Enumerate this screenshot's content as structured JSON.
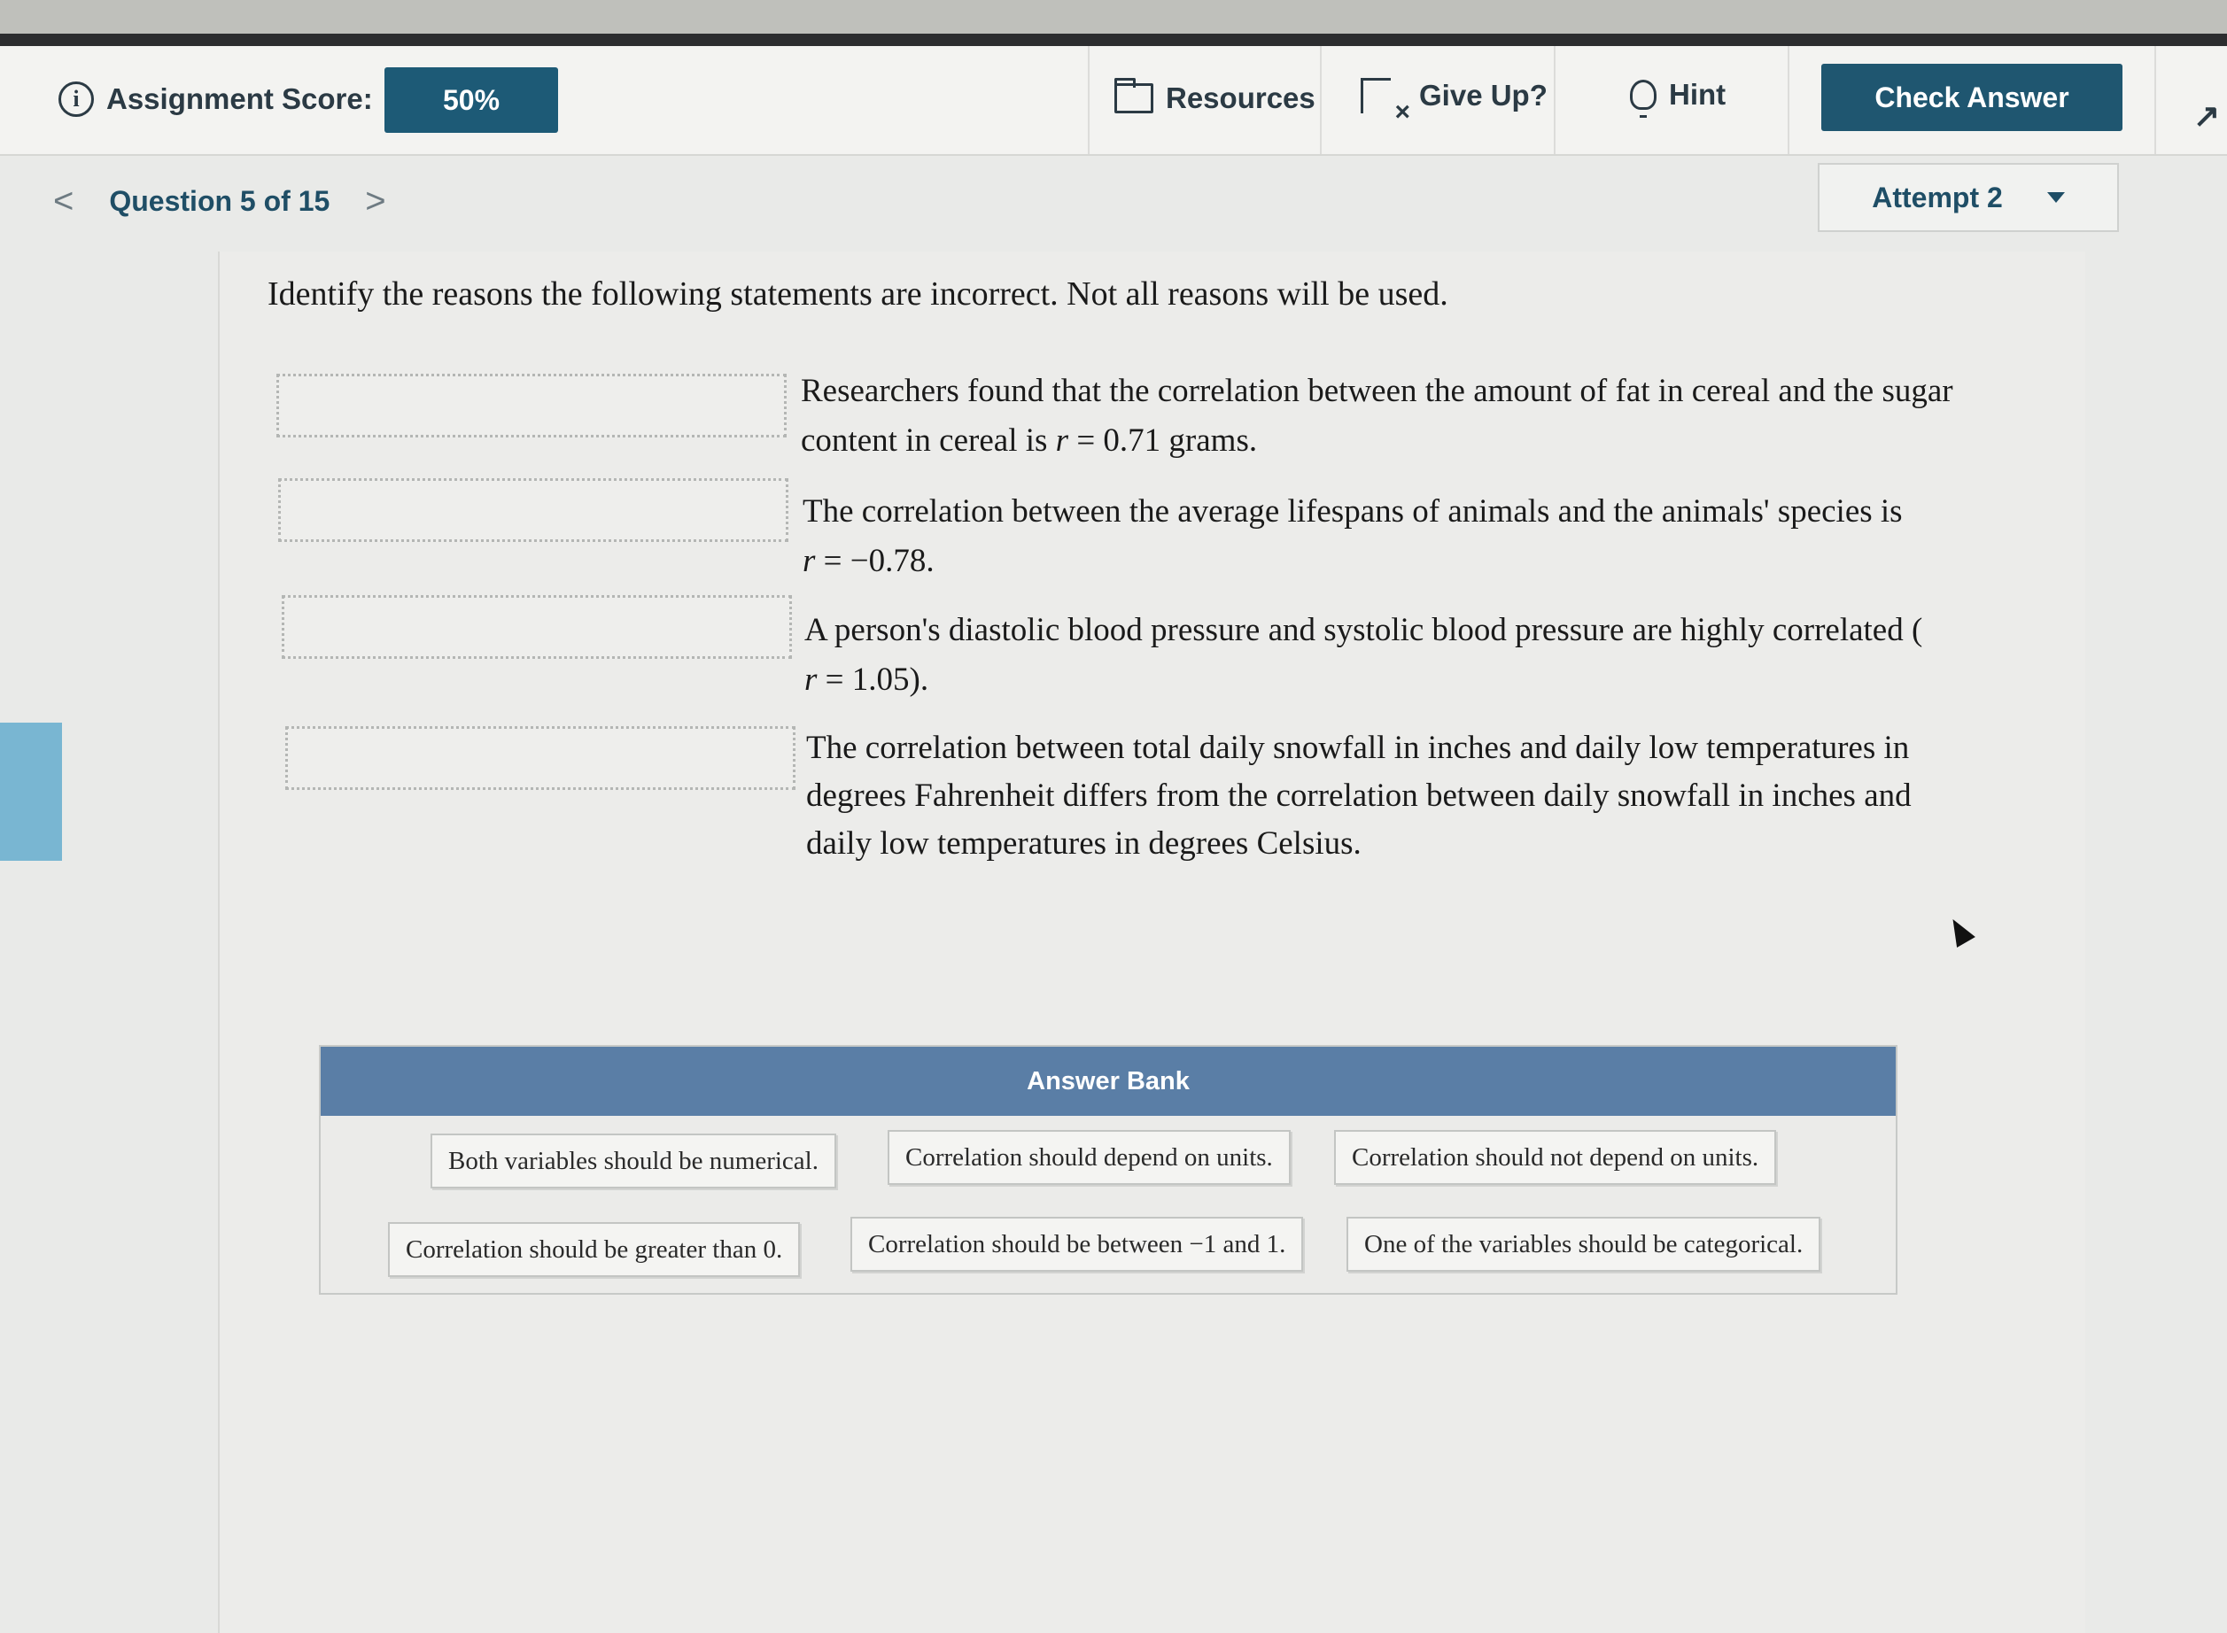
{
  "header": {
    "score_label": "Assignment Score:",
    "score_value": "50%",
    "resources": "Resources",
    "give_up": "Give Up?",
    "hint": "Hint",
    "check_answer": "Check Answer"
  },
  "nav": {
    "question": "Question 5 of 15",
    "prev": "<",
    "next": ">",
    "attempt": "Attempt 2"
  },
  "prompt": "Identify the reasons the following statements are incorrect. Not all reasons will be used.",
  "statements": [
    {
      "text1": "Researchers found that the correlation between the amount of fat in cereal and the sugar",
      "text2": "content in cereal is ",
      "var": "r",
      "text3": " = 0.71 grams."
    },
    {
      "text1": "The correlation between the average lifespans of animals and the animals' species is",
      "var": "r",
      "text3": " = −0.78."
    },
    {
      "text1": "A person's diastolic blood pressure and systolic blood pressure are highly correlated (",
      "var": "r",
      "text3": " = 1.05)."
    },
    {
      "text1": "The correlation between total daily snowfall in inches and daily low temperatures in",
      "text2": "degrees Fahrenheit differs from the correlation between daily snowfall in inches and",
      "text3": "daily low temperatures in degrees Celsius."
    }
  ],
  "bank": {
    "title": "Answer Bank",
    "chips": [
      "Both variables should be numerical.",
      "Correlation should depend on units.",
      "Correlation should not depend on units.",
      "Correlation should be greater than 0.",
      "Correlation should be between −1 and 1.",
      "One of the variables should be categorical."
    ]
  },
  "icons": {
    "info": "i",
    "expand": "↗"
  }
}
